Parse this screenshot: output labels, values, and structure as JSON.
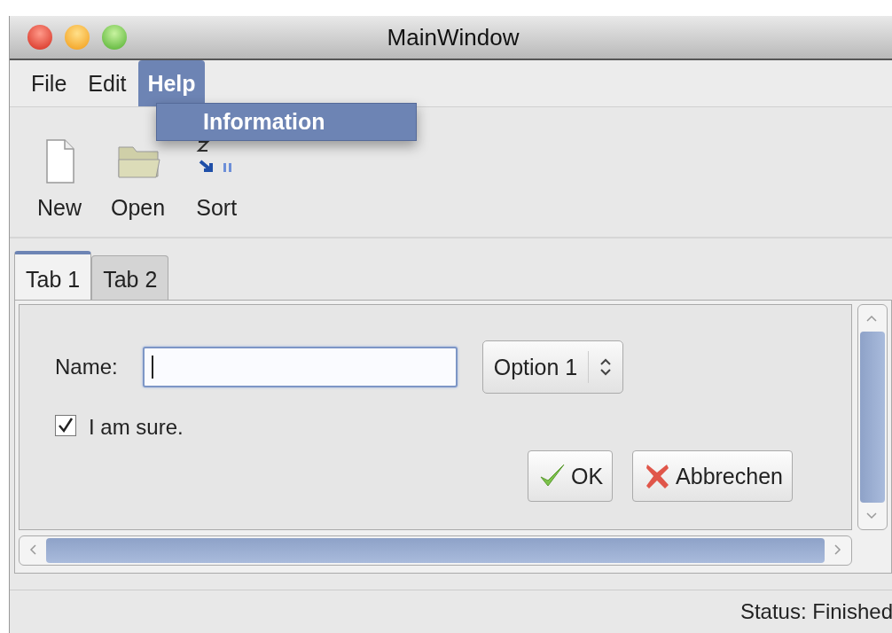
{
  "window": {
    "title": "MainWindow"
  },
  "menu": [
    {
      "label": "File",
      "selected": false
    },
    {
      "label": "Edit",
      "selected": false
    },
    {
      "label": "Help",
      "selected": true
    }
  ],
  "open_menu": {
    "items": [
      {
        "label": "Information",
        "selected": true
      }
    ]
  },
  "toolbar": [
    {
      "label": "New",
      "kind": "new"
    },
    {
      "label": "Open",
      "kind": "open"
    },
    {
      "label": "Sort",
      "kind": "sort"
    }
  ],
  "tabs": [
    {
      "label": "Tab 1",
      "selected": true
    },
    {
      "label": "Tab 2",
      "selected": false
    }
  ],
  "form": {
    "name_label": "Name:",
    "combo_value": "Option 1",
    "checkbox": {
      "label": "I am sure.",
      "checked": true
    },
    "buttons": [
      {
        "label": "OK",
        "kind": "ok"
      },
      {
        "label": "Abbrechen",
        "kind": "cancel"
      }
    ]
  },
  "status_bar": {
    "text": "Status: Finished"
  }
}
